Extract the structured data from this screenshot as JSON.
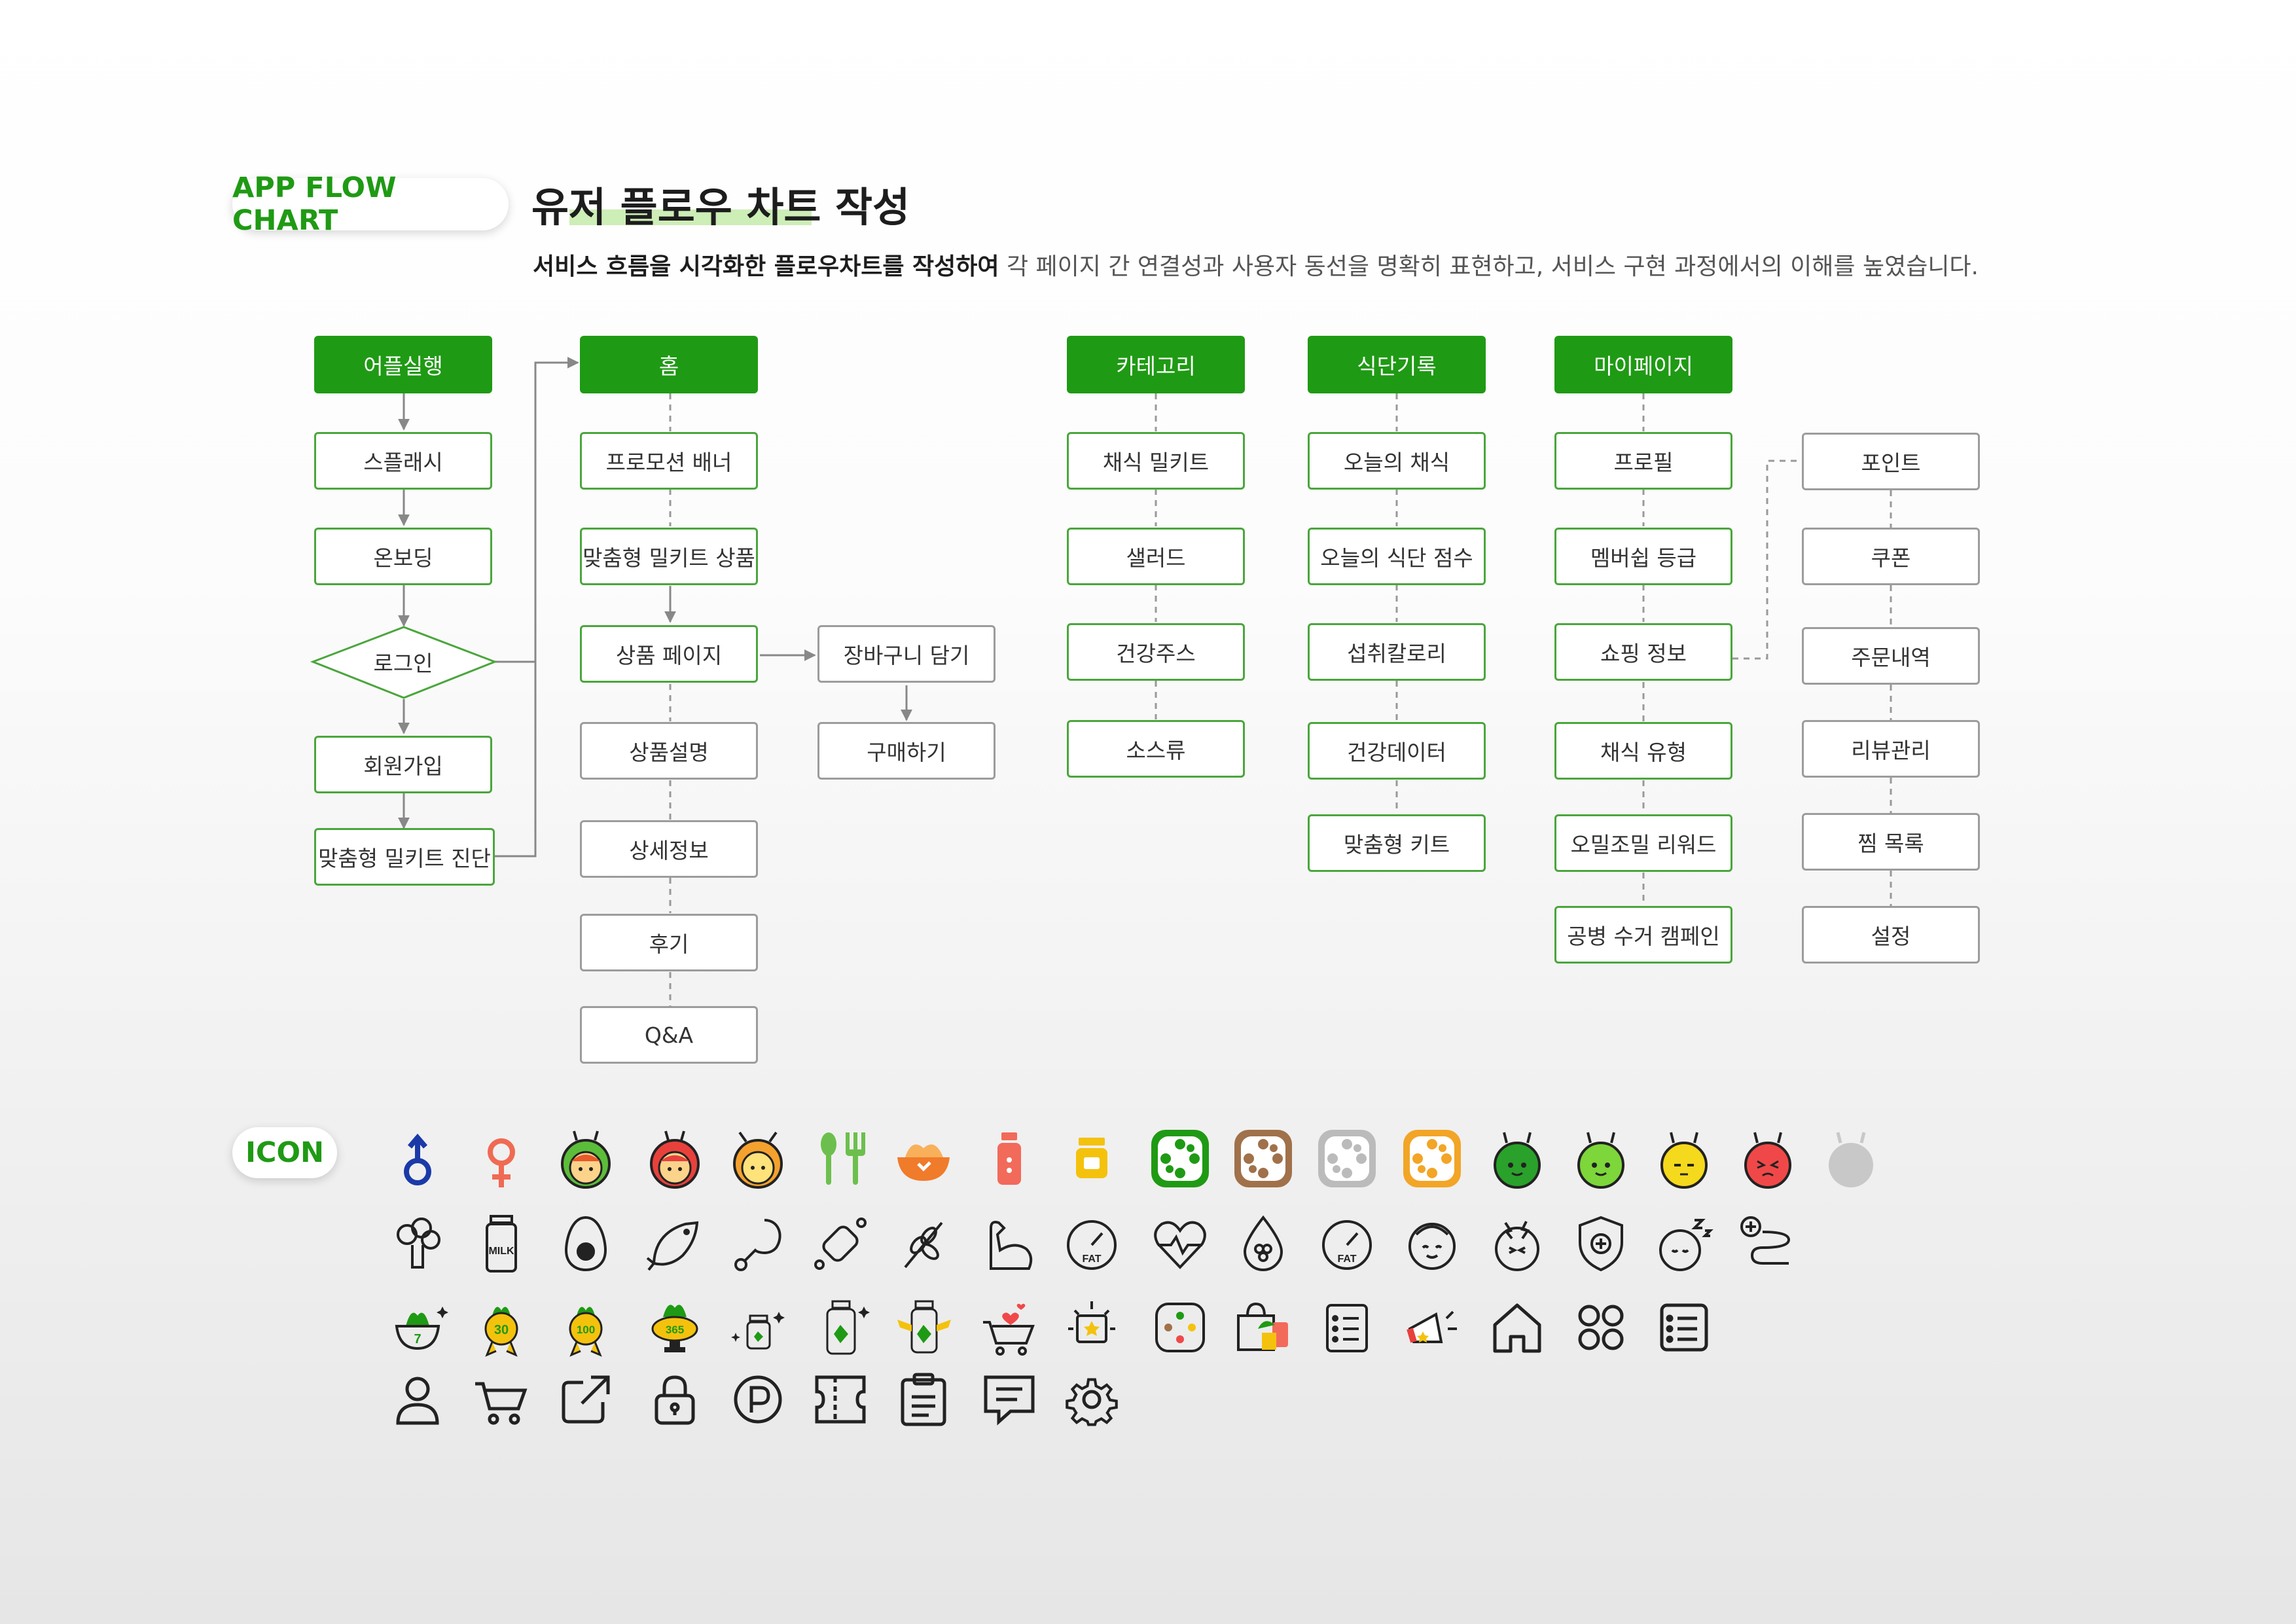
{
  "header": {
    "tag": "APP FLOW CHART",
    "title": "유저 플로우 차트 작성",
    "subtitle_bold": "서비스 흐름을 시각화한 플로우차트를 작성하여",
    "subtitle_rest": " 각 페이지 간 연결성과 사용자 동선을 명확히 표현하고, 서비스 구현 과정에서의 이해를 높였습니다."
  },
  "flow": {
    "start": {
      "head": "어플실행",
      "items": [
        "스플래시",
        "온보딩",
        "로그인",
        "회원가입",
        "맞춤형 밀키트 진단"
      ]
    },
    "home": {
      "head": "홈",
      "items": [
        "프로모션 배너",
        "맞춤형 밀키트 상품",
        "상품 페이지",
        "상품설명",
        "상세정보",
        "후기",
        "Q&A"
      ]
    },
    "cart": {
      "items": [
        "장바구니 담기",
        "구매하기"
      ]
    },
    "category": {
      "head": "카테고리",
      "items": [
        "채식 밀키트",
        "샐러드",
        "건강주스",
        "소스류"
      ]
    },
    "diet": {
      "head": "식단기록",
      "items": [
        "오늘의 채식",
        "오늘의 식단 점수",
        "섭취칼로리",
        "건강데이터",
        "맞춤형 키트"
      ]
    },
    "mypage": {
      "head": "마이페이지",
      "items": [
        "프로필",
        "멤버쉽 등급",
        "쇼핑 정보",
        "채식 유형",
        "오밀조밀 리워드",
        "공병 수거 캠페인"
      ]
    },
    "shopping": {
      "items": [
        "포인트",
        "쿠폰",
        "주문내역",
        "리뷰관리",
        "찜 목록",
        "설정"
      ]
    }
  },
  "colors": {
    "brand_green": "#1f9a14",
    "node_border": "#4aa63c",
    "sub_border": "#9c9c9c"
  },
  "icons": {
    "label": "ICON",
    "badges": [
      "7",
      "30",
      "100",
      "365"
    ],
    "milk": "MILK",
    "fat": "FAT"
  }
}
